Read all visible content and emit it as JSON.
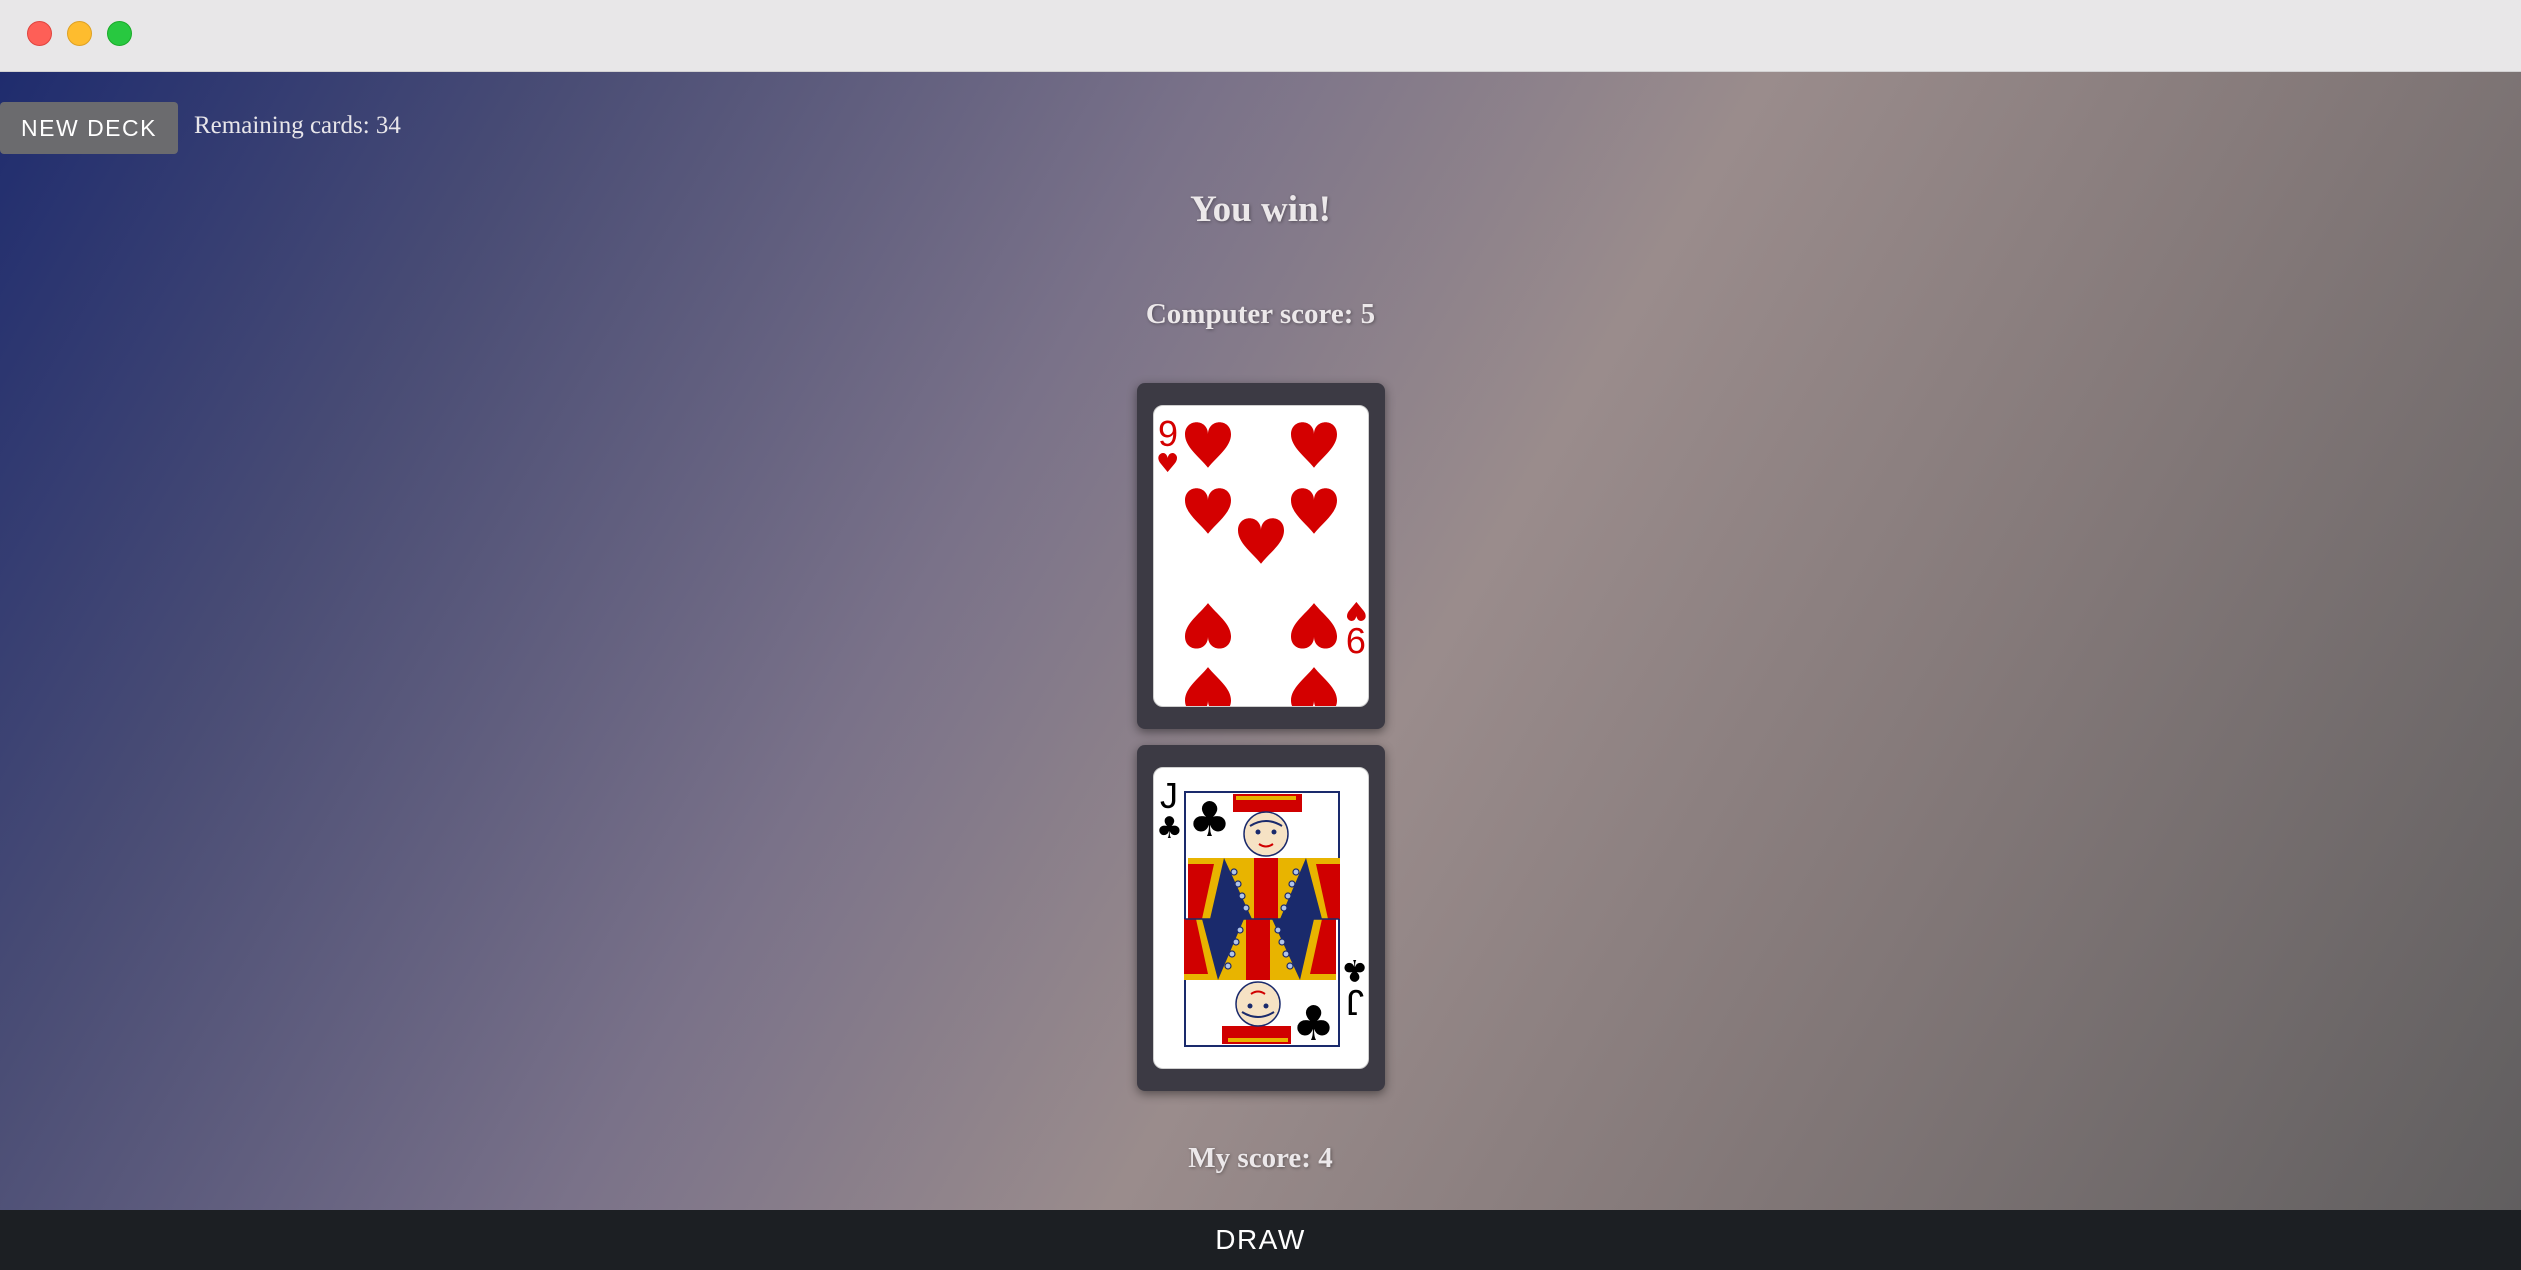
{
  "window": {
    "controls": [
      "close",
      "minimize",
      "maximize"
    ]
  },
  "toolbar": {
    "new_deck_label": "NEW DECK",
    "remaining_text": "Remaining cards: 34"
  },
  "game": {
    "result": "You win!",
    "computer_score": "Computer score: 5",
    "my_score": "My score: 4",
    "computer_card": {
      "rank": "9",
      "suit": "hearts",
      "suit_glyph": "♥",
      "color": "#d40000"
    },
    "player_card": {
      "rank": "J",
      "suit": "clubs",
      "suit_glyph": "♣",
      "color": "#000000"
    }
  },
  "footer": {
    "draw_label": "DRAW"
  }
}
